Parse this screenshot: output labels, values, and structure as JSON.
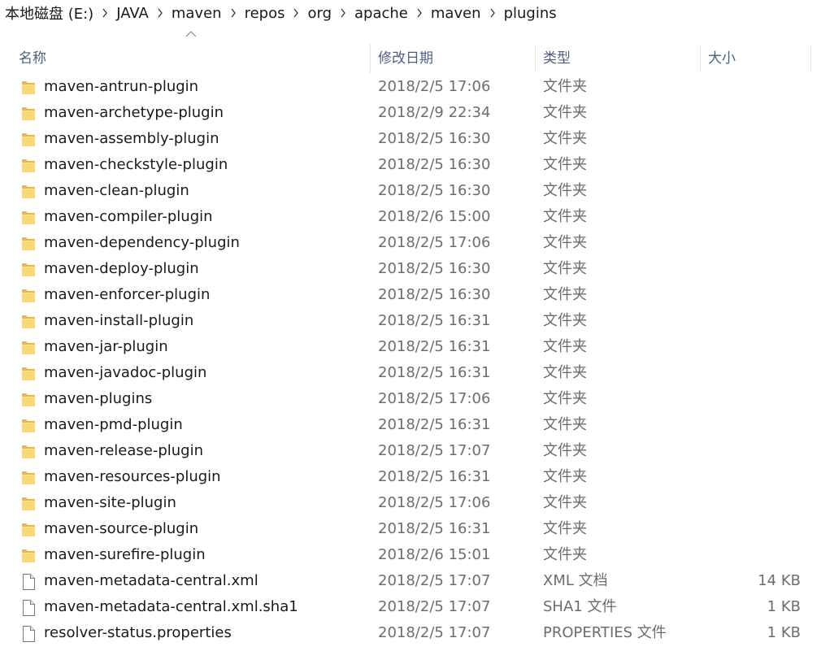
{
  "breadcrumb": [
    "本地磁盘 (E:)",
    "JAVA",
    "maven",
    "repos",
    "org",
    "apache",
    "maven",
    "plugins"
  ],
  "columns": {
    "name": "名称",
    "date": "修改日期",
    "type": "类型",
    "size": "大小"
  },
  "sort": {
    "column": "name",
    "direction": "ascending"
  },
  "files": [
    {
      "name": "maven-antrun-plugin",
      "date": "2018/2/5 17:06",
      "type": "文件夹",
      "size": "",
      "icon": "folder-icon"
    },
    {
      "name": "maven-archetype-plugin",
      "date": "2018/2/9 22:34",
      "type": "文件夹",
      "size": "",
      "icon": "folder-icon"
    },
    {
      "name": "maven-assembly-plugin",
      "date": "2018/2/5 16:30",
      "type": "文件夹",
      "size": "",
      "icon": "folder-icon"
    },
    {
      "name": "maven-checkstyle-plugin",
      "date": "2018/2/5 16:30",
      "type": "文件夹",
      "size": "",
      "icon": "folder-icon"
    },
    {
      "name": "maven-clean-plugin",
      "date": "2018/2/5 16:30",
      "type": "文件夹",
      "size": "",
      "icon": "folder-icon"
    },
    {
      "name": "maven-compiler-plugin",
      "date": "2018/2/6 15:00",
      "type": "文件夹",
      "size": "",
      "icon": "folder-icon"
    },
    {
      "name": "maven-dependency-plugin",
      "date": "2018/2/5 17:06",
      "type": "文件夹",
      "size": "",
      "icon": "folder-icon"
    },
    {
      "name": "maven-deploy-plugin",
      "date": "2018/2/5 16:30",
      "type": "文件夹",
      "size": "",
      "icon": "folder-icon"
    },
    {
      "name": "maven-enforcer-plugin",
      "date": "2018/2/5 16:30",
      "type": "文件夹",
      "size": "",
      "icon": "folder-icon"
    },
    {
      "name": "maven-install-plugin",
      "date": "2018/2/5 16:31",
      "type": "文件夹",
      "size": "",
      "icon": "folder-icon"
    },
    {
      "name": "maven-jar-plugin",
      "date": "2018/2/5 16:31",
      "type": "文件夹",
      "size": "",
      "icon": "folder-icon"
    },
    {
      "name": "maven-javadoc-plugin",
      "date": "2018/2/5 16:31",
      "type": "文件夹",
      "size": "",
      "icon": "folder-icon"
    },
    {
      "name": "maven-plugins",
      "date": "2018/2/5 17:06",
      "type": "文件夹",
      "size": "",
      "icon": "folder-icon"
    },
    {
      "name": "maven-pmd-plugin",
      "date": "2018/2/5 16:31",
      "type": "文件夹",
      "size": "",
      "icon": "folder-icon"
    },
    {
      "name": "maven-release-plugin",
      "date": "2018/2/5 17:07",
      "type": "文件夹",
      "size": "",
      "icon": "folder-icon"
    },
    {
      "name": "maven-resources-plugin",
      "date": "2018/2/5 16:31",
      "type": "文件夹",
      "size": "",
      "icon": "folder-icon"
    },
    {
      "name": "maven-site-plugin",
      "date": "2018/2/5 17:06",
      "type": "文件夹",
      "size": "",
      "icon": "folder-icon"
    },
    {
      "name": "maven-source-plugin",
      "date": "2018/2/5 16:31",
      "type": "文件夹",
      "size": "",
      "icon": "folder-icon"
    },
    {
      "name": "maven-surefire-plugin",
      "date": "2018/2/6 15:01",
      "type": "文件夹",
      "size": "",
      "icon": "folder-icon"
    },
    {
      "name": "maven-metadata-central.xml",
      "date": "2018/2/5 17:07",
      "type": "XML 文档",
      "size": "14 KB",
      "icon": "file-icon"
    },
    {
      "name": "maven-metadata-central.xml.sha1",
      "date": "2018/2/5 17:07",
      "type": "SHA1 文件",
      "size": "1 KB",
      "icon": "file-icon"
    },
    {
      "name": "resolver-status.properties",
      "date": "2018/2/5 17:07",
      "type": "PROPERTIES 文件",
      "size": "1 KB",
      "icon": "file-icon"
    }
  ],
  "colors": {
    "header_text": "#4d6082",
    "secondary_text": "#6d6d6d",
    "folder_yellow": "#f8d775"
  }
}
